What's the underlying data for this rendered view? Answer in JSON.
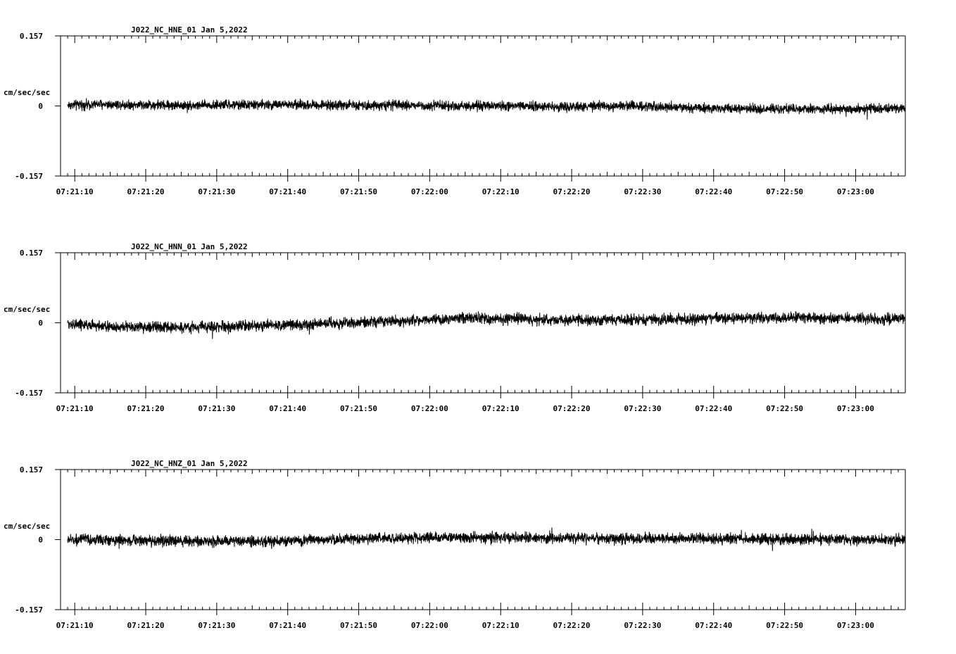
{
  "colors": {
    "background": "#ffffff",
    "ink": "#000000"
  },
  "chart_data": [
    {
      "type": "line",
      "title": "J022_NC_HNE_01   Jan 5,2022",
      "ylabel": "cm/sec/sec",
      "ylim": [
        -0.157,
        0.157
      ],
      "y_ticks": [
        "0.157",
        "0",
        "-0.157"
      ],
      "xlim": [
        "07:21:08.0",
        "07:23:07.0"
      ],
      "x_ticks": [
        "07:21:10",
        "07:21:20",
        "07:21:30",
        "07:21:40",
        "07:21:50",
        "07:22:00",
        "07:22:10",
        "07:22:20",
        "07:22:30",
        "07:22:40",
        "07:22:50",
        "07:23:00"
      ],
      "series": [
        {
          "x": [
            "07:21:09",
            "07:21:14",
            "07:21:26",
            "07:21:36",
            "07:21:50",
            "07:22:00",
            "07:22:20",
            "07:22:29",
            "07:22:40",
            "07:22:53",
            "07:23:05"
          ],
          "trend": [
            0.002,
            0.004,
            0.001,
            0.003,
            0.002,
            0.001,
            -0.002,
            0.001,
            -0.006,
            -0.007,
            -0.006
          ],
          "amplitude": 0.016
        }
      ]
    },
    {
      "type": "line",
      "title": "J022_NC_HNN_01   Jan 5,2022",
      "ylabel": "cm/sec/sec",
      "ylim": [
        -0.157,
        0.157
      ],
      "y_ticks": [
        "0.157",
        "0",
        "-0.157"
      ],
      "xlim": [
        "07:21:08.0",
        "07:23:07.0"
      ],
      "x_ticks": [
        "07:21:10",
        "07:21:20",
        "07:21:30",
        "07:21:40",
        "07:21:50",
        "07:22:00",
        "07:22:10",
        "07:22:20",
        "07:22:30",
        "07:22:40",
        "07:22:50",
        "07:23:00"
      ],
      "series": [
        {
          "x": [
            "07:21:09",
            "07:21:16",
            "07:21:26",
            "07:21:40",
            "07:21:50",
            "07:22:05",
            "07:22:20",
            "07:22:35",
            "07:22:48",
            "07:23:05"
          ],
          "trend": [
            -0.002,
            -0.01,
            -0.01,
            -0.005,
            0.001,
            0.01,
            0.006,
            0.008,
            0.012,
            0.008
          ],
          "amplitude": 0.018
        }
      ]
    },
    {
      "type": "line",
      "title": "J022_NC_HNZ_01   Jan 5,2022",
      "ylabel": "cm/sec/sec",
      "ylim": [
        -0.157,
        0.157
      ],
      "y_ticks": [
        "0.157",
        "0",
        "-0.157"
      ],
      "xlim": [
        "07:21:08.0",
        "07:23:07.0"
      ],
      "x_ticks": [
        "07:21:10",
        "07:21:20",
        "07:21:30",
        "07:21:40",
        "07:21:50",
        "07:22:00",
        "07:22:10",
        "07:22:20",
        "07:22:30",
        "07:22:40",
        "07:22:50",
        "07:23:00"
      ],
      "series": [
        {
          "x": [
            "07:21:09",
            "07:21:20",
            "07:21:36",
            "07:21:50",
            "07:22:04",
            "07:22:20",
            "07:22:35",
            "07:22:50",
            "07:23:05"
          ],
          "trend": [
            0.0,
            -0.002,
            -0.005,
            0.002,
            0.005,
            0.003,
            0.003,
            0.001,
            -0.001
          ],
          "amplitude": 0.018
        }
      ]
    }
  ]
}
